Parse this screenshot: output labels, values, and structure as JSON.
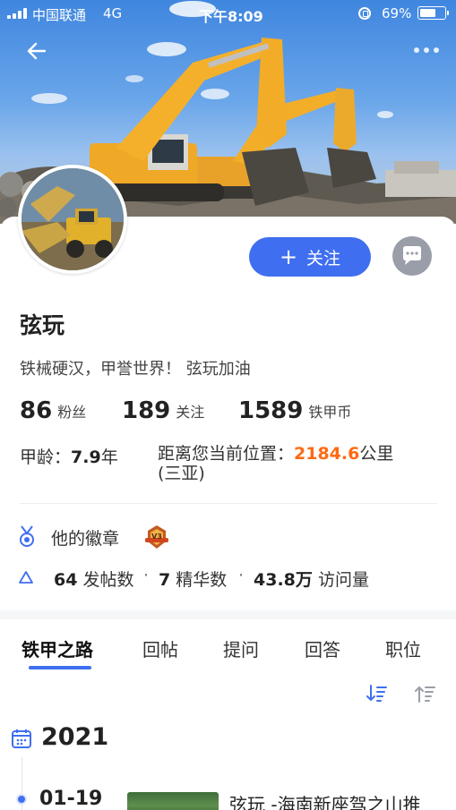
{
  "status_bar": {
    "carrier": "中国联通",
    "network": "4G",
    "time": "下午8:09",
    "battery_percent": "69%",
    "battery_level": 0.69
  },
  "profile": {
    "name": "弦玩",
    "bio": "铁械硬汉，甲誉世界！ 弦玩加油",
    "follow_label": "关注"
  },
  "stats": [
    {
      "value": "86",
      "label": "粉丝"
    },
    {
      "value": "189",
      "label": "关注"
    },
    {
      "value": "1589",
      "label": "铁甲币"
    }
  ],
  "age": {
    "label": "甲龄：",
    "value": "7.9",
    "unit": "年"
  },
  "distance": {
    "label": "距离您当前位置：",
    "value": "2184.6",
    "unit": "公里",
    "place": "(三亚)"
  },
  "badges": {
    "label": "他的徽章",
    "badge_text": "V3"
  },
  "posts": {
    "post_count": "64",
    "post_label": "发帖数",
    "essence_count": "7",
    "essence_label": "精华数",
    "visits": "43.8万",
    "visits_label": "访问量",
    "separator": "·"
  },
  "tabs": [
    {
      "label": "铁甲之路",
      "active": true
    },
    {
      "label": "回帖",
      "active": false
    },
    {
      "label": "提问",
      "active": false
    },
    {
      "label": "回答",
      "active": false
    },
    {
      "label": "职位",
      "active": false
    }
  ],
  "timeline": {
    "year": "2021",
    "entries": [
      {
        "date": "01-19",
        "title": "弦玩 -海南新座驾之山推"
      }
    ]
  },
  "colors": {
    "accent": "#3f6ff0",
    "highlight": "#ff6a13",
    "chat_button": "#999ea8"
  }
}
